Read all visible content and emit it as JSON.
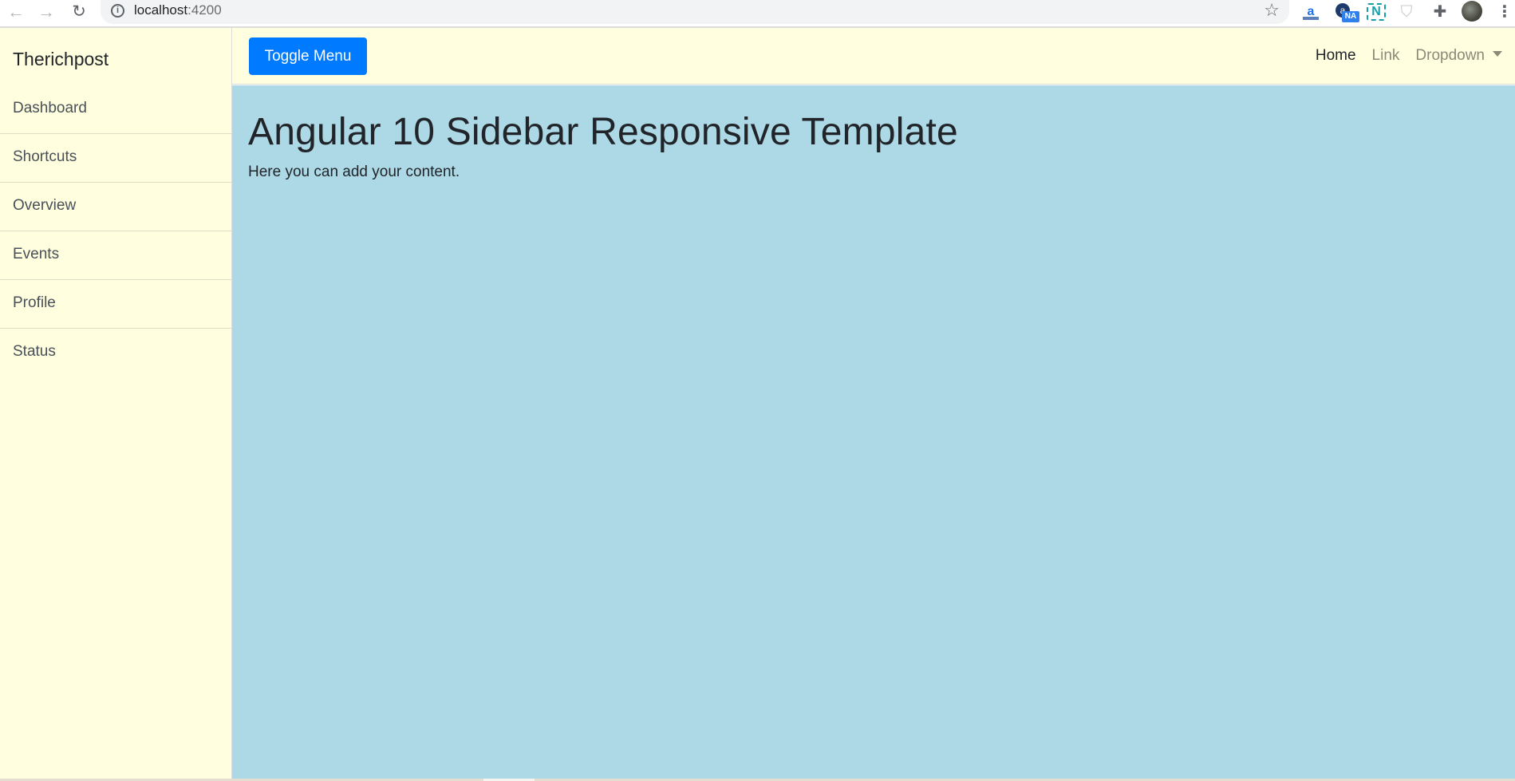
{
  "browser": {
    "back_icon": "arrow-left-icon",
    "forward_icon": "arrow-right-icon",
    "reload_icon": "reload-icon",
    "url_host": "localhost",
    "url_port": ":4200",
    "bookmark_icon": "star-icon",
    "extensions": [
      {
        "name": "amazon-assistant-extension",
        "glyph": "a"
      },
      {
        "name": "alexa-rank-extension",
        "glyph": "a",
        "badge": "NA"
      },
      {
        "name": "n-extension",
        "glyph": "N"
      },
      {
        "name": "shield-extension",
        "glyph": "⛉"
      },
      {
        "name": "extensions-puzzle",
        "glyph": "✚"
      }
    ],
    "menu_glyph": "⋮"
  },
  "sidebar": {
    "brand": "Therichpost",
    "items": [
      {
        "label": "Dashboard"
      },
      {
        "label": "Shortcuts"
      },
      {
        "label": "Overview"
      },
      {
        "label": "Events"
      },
      {
        "label": "Profile"
      },
      {
        "label": "Status"
      }
    ]
  },
  "navbar": {
    "toggle_label": "Toggle Menu",
    "links": [
      {
        "label": "Home",
        "active": true
      },
      {
        "label": "Link",
        "active": false
      },
      {
        "label": "Dropdown",
        "active": false
      }
    ]
  },
  "main": {
    "title": "Angular 10 Sidebar Responsive Template",
    "text": "Here you can add your content."
  },
  "colors": {
    "sidebar_bg": "#ffffe0",
    "content_bg": "#add8e6",
    "primary": "#007bff"
  }
}
